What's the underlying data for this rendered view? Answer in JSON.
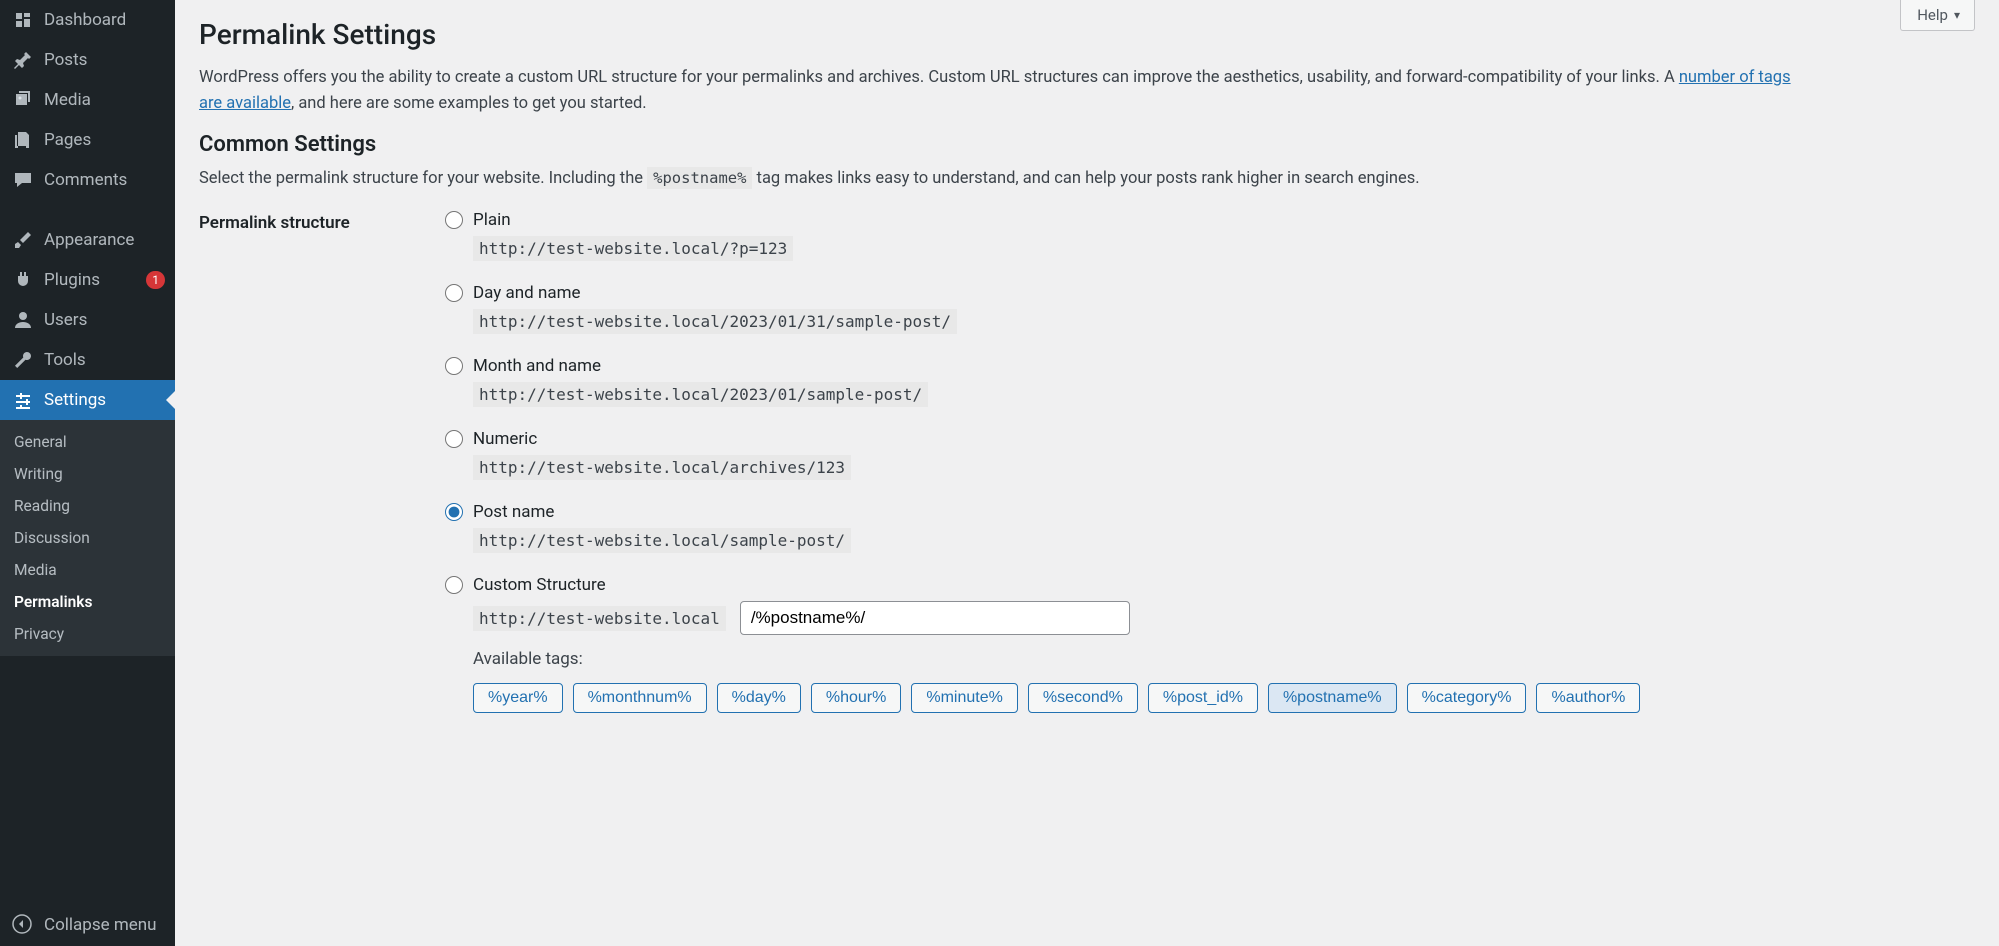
{
  "help_label": "Help",
  "sidebar": {
    "items": [
      {
        "label": "Dashboard",
        "icon": "dashboard"
      },
      {
        "label": "Posts",
        "icon": "pin"
      },
      {
        "label": "Media",
        "icon": "media"
      },
      {
        "label": "Pages",
        "icon": "pages"
      },
      {
        "label": "Comments",
        "icon": "comment"
      },
      {
        "label": "Appearance",
        "icon": "brush"
      },
      {
        "label": "Plugins",
        "icon": "plug",
        "badge": "1"
      },
      {
        "label": "Users",
        "icon": "user"
      },
      {
        "label": "Tools",
        "icon": "wrench"
      },
      {
        "label": "Settings",
        "icon": "sliders",
        "current": true
      }
    ],
    "submenu": [
      {
        "label": "General"
      },
      {
        "label": "Writing"
      },
      {
        "label": "Reading"
      },
      {
        "label": "Discussion"
      },
      {
        "label": "Media"
      },
      {
        "label": "Permalinks",
        "current": true
      },
      {
        "label": "Privacy"
      }
    ],
    "collapse": "Collapse menu"
  },
  "page": {
    "title": "Permalink Settings",
    "intro_1": "WordPress offers you the ability to create a custom URL structure for your permalinks and archives. Custom URL structures can improve the aesthetics, usability, and forward-compatibility of your links. A ",
    "intro_link": "number of tags are available",
    "intro_2": ", and here are some examples to get you started.",
    "common_heading": "Common Settings",
    "common_text_1": "Select the permalink structure for your website. Including the ",
    "common_tag": "%postname%",
    "common_text_2": " tag makes links easy to understand, and can help your posts rank higher in search engines.",
    "th_label": "Permalink structure"
  },
  "structures": [
    {
      "name": "Plain",
      "example": "http://test-website.local/?p=123"
    },
    {
      "name": "Day and name",
      "example": "http://test-website.local/2023/01/31/sample-post/"
    },
    {
      "name": "Month and name",
      "example": "http://test-website.local/2023/01/sample-post/"
    },
    {
      "name": "Numeric",
      "example": "http://test-website.local/archives/123"
    },
    {
      "name": "Post name",
      "example": "http://test-website.local/sample-post/",
      "checked": true
    },
    {
      "name": "Custom Structure"
    }
  ],
  "custom": {
    "base": "http://test-website.local",
    "value": "/%postname%/",
    "available_label": "Available tags:",
    "tags": [
      {
        "t": "%year%"
      },
      {
        "t": "%monthnum%"
      },
      {
        "t": "%day%"
      },
      {
        "t": "%hour%"
      },
      {
        "t": "%minute%"
      },
      {
        "t": "%second%"
      },
      {
        "t": "%post_id%"
      },
      {
        "t": "%postname%",
        "active": true
      },
      {
        "t": "%category%"
      },
      {
        "t": "%author%"
      }
    ]
  }
}
